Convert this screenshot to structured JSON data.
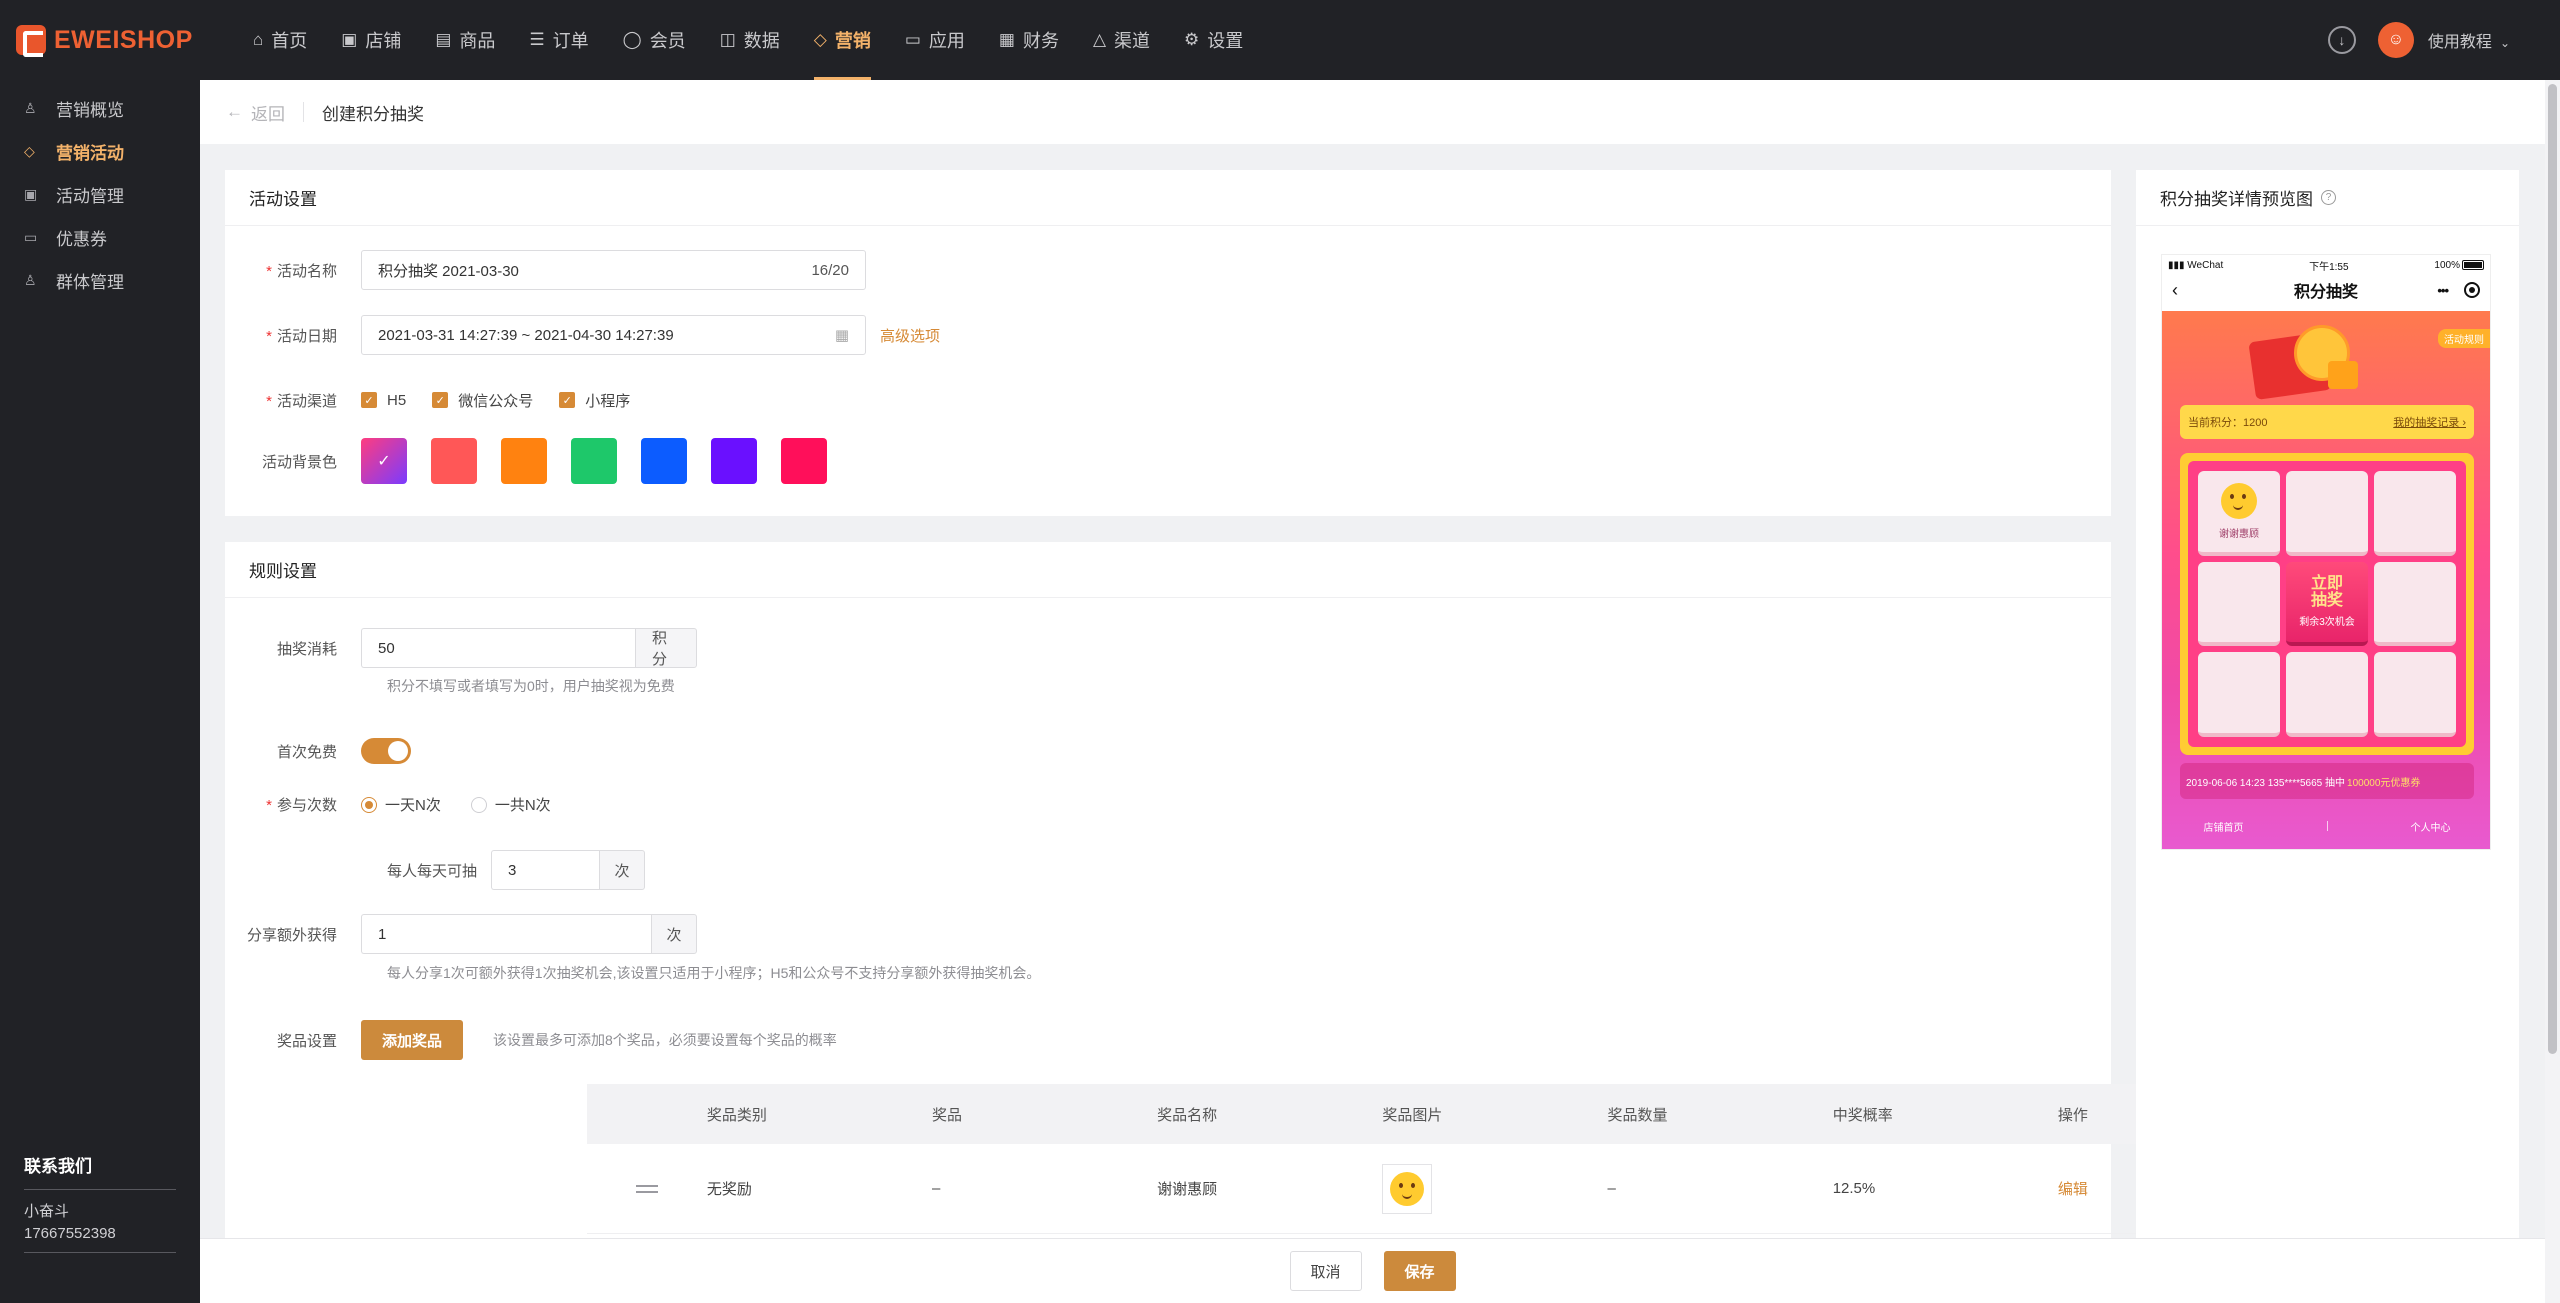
{
  "brand": {
    "name": "EWEISHOP",
    "color": "#ee6133"
  },
  "nav": {
    "items": [
      {
        "label": "首页",
        "icon": "home-icon"
      },
      {
        "label": "店铺",
        "icon": "shop-icon"
      },
      {
        "label": "商品",
        "icon": "goods-icon"
      },
      {
        "label": "订单",
        "icon": "order-icon"
      },
      {
        "label": "会员",
        "icon": "member-icon"
      },
      {
        "label": "数据",
        "icon": "data-icon"
      },
      {
        "label": "营销",
        "icon": "tag-icon"
      },
      {
        "label": "应用",
        "icon": "app-icon"
      },
      {
        "label": "财务",
        "icon": "finance-icon"
      },
      {
        "label": "渠道",
        "icon": "channel-icon"
      },
      {
        "label": "设置",
        "icon": "settings-icon"
      }
    ],
    "active": "营销",
    "tutorial": "使用教程"
  },
  "sidebar": {
    "items": [
      {
        "label": "营销概览",
        "icon": "overview-icon"
      },
      {
        "label": "营销活动",
        "icon": "tag-icon"
      },
      {
        "label": "活动管理",
        "icon": "manage-icon"
      },
      {
        "label": "优惠券",
        "icon": "coupon-icon"
      },
      {
        "label": "群体管理",
        "icon": "group-icon"
      }
    ],
    "active": "营销活动",
    "contact": {
      "title": "联系我们",
      "name": "小奋斗",
      "phone": "17667552398"
    }
  },
  "breadcrumb": {
    "back": "返回",
    "title": "创建积分抽奖"
  },
  "activity": {
    "section_title": "活动设置",
    "name_label": "活动名称",
    "name_value": "积分抽奖 2021-03-30",
    "name_count": "16/20",
    "date_label": "活动日期",
    "date_value": "2021-03-31 14:27:39 ~ 2021-04-30 14:27:39",
    "advanced": "高级选项",
    "channel_label": "活动渠道",
    "channels": [
      "H5",
      "微信公众号",
      "小程序"
    ],
    "bg_label": "活动背景色",
    "bg_colors": [
      "#ff4e6a",
      "#ff5757",
      "#ff8210",
      "#1ec86a",
      "#0c5cff",
      "#6a10ff",
      "#ff0f5a"
    ],
    "bg_selected": 0
  },
  "rules": {
    "section_title": "规则设置",
    "cost_label": "抽奖消耗",
    "cost_value": "50",
    "cost_unit": "积分",
    "cost_hint": "积分不填写或者填写为0时，用户抽奖视为免费",
    "first_free_label": "首次免费",
    "first_free_on": true,
    "times_label": "参与次数",
    "times_options": [
      "一天N次",
      "一共N次"
    ],
    "times_selected": 0,
    "daily_label": "每人每天可抽",
    "daily_value": "3",
    "daily_unit": "次",
    "share_label": "分享额外获得",
    "share_value": "1",
    "share_unit": "次",
    "share_hint": "每人分享1次可额外获得1次抽奖机会,该设置只适用于小程序；H5和公众号不支持分享额外获得抽奖机会。",
    "prize_label": "奖品设置",
    "add_prize": "添加奖品",
    "prize_hint": "该设置最多可添加8个奖品，必须要设置每个奖品的概率"
  },
  "prize_table": {
    "headers": [
      "奖品类别",
      "奖品",
      "奖品名称",
      "奖品图片",
      "奖品数量",
      "中奖概率",
      "操作"
    ],
    "rows": [
      {
        "type": "无奖励",
        "prize": "–",
        "name": "谢谢惠顾",
        "qty": "–",
        "prob": "12.5%",
        "action": "编辑"
      }
    ]
  },
  "footer": {
    "cancel": "取消",
    "save": "保存"
  },
  "preview": {
    "title": "积分抽奖详情预览图",
    "status_carrier": "WeChat",
    "status_time": "下午1:55",
    "status_battery": "100%",
    "page_title": "积分抽奖",
    "rule_tag": "活动规则",
    "points": "当前积分：1200",
    "records": "我的抽奖记录 ›",
    "thanks": "谢谢惠顾",
    "go_line1": "立即",
    "go_line2": "抽奖",
    "go_remaining": "剩余3次机会",
    "winner_text": "2019-06-06 14:23  135****5665  抽中",
    "winner_prize": "100000元优惠券",
    "foot_home": "店铺首页",
    "foot_me": "个人中心"
  }
}
